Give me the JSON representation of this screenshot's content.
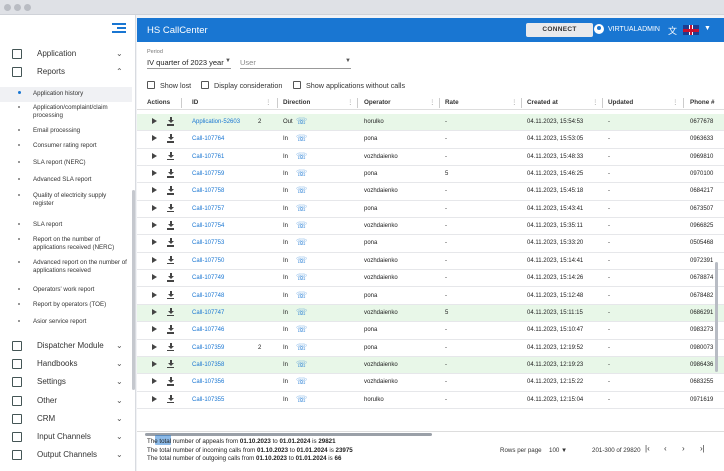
{
  "app": {
    "title": "HS CallCenter",
    "connect_label": "CONNECT",
    "username": "VIRTUALADMIN"
  },
  "colors": {
    "accent": "#1976d2",
    "highlight_row": "#e8f7e8"
  },
  "sidebar": {
    "groups_top": [
      {
        "label": "Application",
        "icon": "monitor-icon"
      },
      {
        "label": "Reports",
        "icon": "grid-icon"
      }
    ],
    "report_items": [
      {
        "label": "Application history",
        "active": true
      },
      {
        "label": "Application/complaint/claim processing"
      },
      {
        "label": "Email processing"
      },
      {
        "label": "Consumer rating report"
      },
      {
        "label": "SLA report (NERC)"
      },
      {
        "label": "Advanced SLA report"
      },
      {
        "label": "Quality of electricity supply register"
      },
      {
        "label": "SLA report"
      },
      {
        "label": "Report on the number of applications received (NERC)"
      },
      {
        "label": "Advanced report on the number of applications received"
      },
      {
        "label": "Operators' work report"
      },
      {
        "label": "Report by operators (TOE)"
      },
      {
        "label": "Asior service report"
      }
    ],
    "groups_bottom": [
      {
        "label": "Dispatcher Module",
        "icon": "dispatcher-icon"
      },
      {
        "label": "Handbooks",
        "icon": "book-icon"
      },
      {
        "label": "Settings",
        "icon": "gear-icon"
      },
      {
        "label": "Other",
        "icon": "dots-icon"
      },
      {
        "label": "CRM",
        "icon": "people-icon"
      },
      {
        "label": "Input Channels",
        "icon": "phone-in-icon"
      },
      {
        "label": "Output Channels",
        "icon": "phone-out-icon"
      }
    ]
  },
  "filters": {
    "period_label": "Period",
    "period_value": "IV quarter of 2023 year",
    "user_placeholder": "User",
    "checkboxes": [
      "Show lost",
      "Display consideration",
      "Show applications without calls"
    ]
  },
  "table": {
    "columns": [
      "Actions",
      "ID",
      "Direction",
      "Operator",
      "Rate",
      "Created at",
      "Updated",
      "Phone #"
    ],
    "rows": [
      {
        "id": "Application-52603",
        "count": "2",
        "dir": "Out",
        "operator": "horulko",
        "rate": "-",
        "created": "04.11.2023, 15:54:53",
        "updated": "-",
        "phone": "0677678",
        "green": true
      },
      {
        "id": "Call-107764",
        "count": "",
        "dir": "In",
        "operator": "pona",
        "rate": "-",
        "created": "04.11.2023, 15:53:05",
        "updated": "-",
        "phone": "0963633",
        "green": false
      },
      {
        "id": "Call-107761",
        "count": "",
        "dir": "In",
        "operator": "vozhdaienko",
        "rate": "-",
        "created": "04.11.2023, 15:48:33",
        "updated": "-",
        "phone": "0969810",
        "green": false
      },
      {
        "id": "Call-107759",
        "count": "",
        "dir": "In",
        "operator": "pona",
        "rate": "5",
        "created": "04.11.2023, 15:46:25",
        "updated": "-",
        "phone": "0970100",
        "green": false
      },
      {
        "id": "Call-107758",
        "count": "",
        "dir": "In",
        "operator": "vozhdaienko",
        "rate": "-",
        "created": "04.11.2023, 15:45:18",
        "updated": "-",
        "phone": "0684217",
        "green": false
      },
      {
        "id": "Call-107757",
        "count": "",
        "dir": "In",
        "operator": "pona",
        "rate": "-",
        "created": "04.11.2023, 15:43:41",
        "updated": "-",
        "phone": "0673507",
        "green": false
      },
      {
        "id": "Call-107754",
        "count": "",
        "dir": "In",
        "operator": "vozhdaienko",
        "rate": "-",
        "created": "04.11.2023, 15:35:11",
        "updated": "-",
        "phone": "0966825",
        "green": false
      },
      {
        "id": "Call-107753",
        "count": "",
        "dir": "In",
        "operator": "pona",
        "rate": "-",
        "created": "04.11.2023, 15:33:20",
        "updated": "-",
        "phone": "0505468",
        "green": false
      },
      {
        "id": "Call-107750",
        "count": "",
        "dir": "In",
        "operator": "vozhdaienko",
        "rate": "-",
        "created": "04.11.2023, 15:14:41",
        "updated": "-",
        "phone": "0972391",
        "green": false
      },
      {
        "id": "Call-107749",
        "count": "",
        "dir": "In",
        "operator": "vozhdaienko",
        "rate": "-",
        "created": "04.11.2023, 15:14:26",
        "updated": "-",
        "phone": "0678874",
        "green": false
      },
      {
        "id": "Call-107748",
        "count": "",
        "dir": "In",
        "operator": "pona",
        "rate": "-",
        "created": "04.11.2023, 15:12:48",
        "updated": "-",
        "phone": "0678482",
        "green": false
      },
      {
        "id": "Call-107747",
        "count": "",
        "dir": "In",
        "operator": "vozhdaienko",
        "rate": "5",
        "created": "04.11.2023, 15:11:15",
        "updated": "-",
        "phone": "0686291",
        "green": true
      },
      {
        "id": "Call-107746",
        "count": "",
        "dir": "In",
        "operator": "pona",
        "rate": "-",
        "created": "04.11.2023, 15:10:47",
        "updated": "-",
        "phone": "0983273",
        "green": false
      },
      {
        "id": "Call-107359",
        "count": "2",
        "dir": "In",
        "operator": "pona",
        "rate": "-",
        "created": "04.11.2023, 12:19:52",
        "updated": "-",
        "phone": "0980073",
        "green": false
      },
      {
        "id": "Call-107358",
        "count": "",
        "dir": "In",
        "operator": "vozhdaienko",
        "rate": "-",
        "created": "04.11.2023, 12:19:23",
        "updated": "-",
        "phone": "0986436",
        "green": true
      },
      {
        "id": "Call-107356",
        "count": "",
        "dir": "In",
        "operator": "vozhdaienko",
        "rate": "-",
        "created": "04.11.2023, 12:15:22",
        "updated": "-",
        "phone": "0683255",
        "green": false
      },
      {
        "id": "Call-107355",
        "count": "",
        "dir": "In",
        "operator": "horulko",
        "rate": "-",
        "created": "04.11.2023, 12:15:04",
        "updated": "-",
        "phone": "0971619",
        "green": false
      }
    ]
  },
  "footer": {
    "line1": {
      "a": "The total number of appeals from ",
      "from": "01.10.2023",
      "b": " to ",
      "to": "01.01.2024",
      "c": " is ",
      "n": "29821"
    },
    "line2": {
      "a": "The total number of incoming calls from ",
      "from": "01.10.2023",
      "b": " to ",
      "to": "01.01.2024",
      "c": " is ",
      "n": "23975"
    },
    "line3": {
      "a": "The total number of outgoing calls from ",
      "from": "01.10.2023",
      "b": " to ",
      "to": "01.01.2024",
      "c": " is ",
      "n": "66"
    },
    "rows_per_page_label": "Rows per page",
    "rows_per_page_value": "100",
    "range": "201-300 of 29820"
  }
}
